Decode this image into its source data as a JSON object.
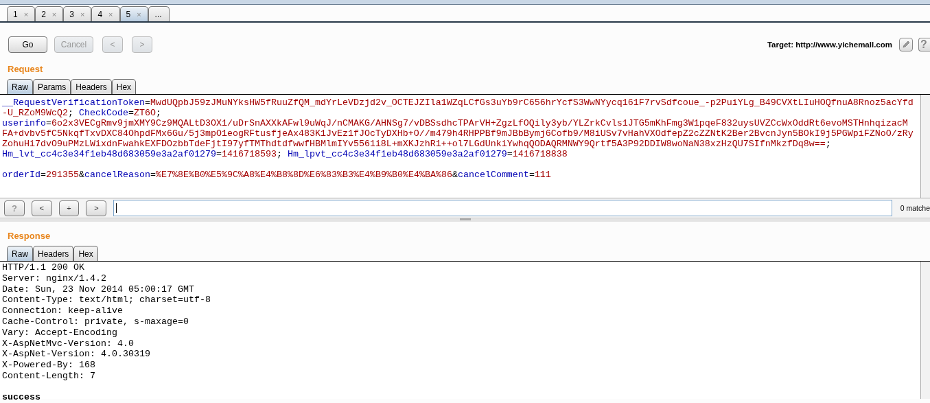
{
  "tabs": [
    {
      "label": "1",
      "close": "×",
      "selected": false
    },
    {
      "label": "2",
      "close": "×",
      "selected": false
    },
    {
      "label": "3",
      "close": "×",
      "selected": false
    },
    {
      "label": "4",
      "close": "×",
      "selected": false
    },
    {
      "label": "5",
      "close": "×",
      "selected": true
    },
    {
      "label": "...",
      "selected": false
    }
  ],
  "toolbar": {
    "buttons": [
      {
        "label": "Go",
        "disabled": false
      },
      {
        "label": "Cancel",
        "disabled": true
      },
      {
        "label": "<",
        "disabled": true
      },
      {
        "label": ">",
        "disabled": true
      }
    ],
    "target": "Target: http://www.yichemall.com",
    "help": "?"
  },
  "request": {
    "title": "Request",
    "tabs": [
      {
        "label": "Raw",
        "selected": true
      },
      {
        "label": "Params",
        "selected": false
      },
      {
        "label": "Headers",
        "selected": false
      },
      {
        "label": "Hex",
        "selected": false
      }
    ],
    "lines": [
      {
        "kind": "params",
        "segments": [
          {
            "kind": "name",
            "text": "__RequestVerificationToken"
          },
          {
            "kind": "punct",
            "text": "="
          },
          {
            "kind": "value",
            "text": "MwdUQpbJ59zJMuNYksHW5fRuuZfQM_mdYrLeVDzjd2v_OCTEJZIla1WZqLCfGs3uYb9rC656hrYcfS3WwNYycq161F7rvSdfcoue_-p2PuiYLg_B49CVXtLIuHOQfnuA8Rnoz5acYfd-U_RZoM9WcQ2"
          },
          {
            "kind": "punct",
            "text": "; "
          },
          {
            "kind": "name",
            "text": "CheckCode"
          },
          {
            "kind": "punct",
            "text": "="
          },
          {
            "kind": "value",
            "text": "ZT6O"
          },
          {
            "kind": "punct",
            "text": ";"
          }
        ]
      },
      {
        "kind": "params",
        "segments": [
          {
            "kind": "name",
            "text": "userinfo"
          },
          {
            "kind": "punct",
            "text": "="
          },
          {
            "kind": "value",
            "text": "6o2x3VECgRmv9jmXMY9Cz9MQALtD3OX1/uDrSnAXXkAFwl9uWqJ/nCMAKG/AHNSg7/vDBSsdhcTPArVH+ZgzLfOQily3yb/YLZrkCvls1JTG5mKhFmg3W1pqeF832uysUVZCcWxOddRt6evoMSTHnhqizacMFA+dvbv5fC5NkqfTxvDXC84OhpdFMx6Gu/5j3mpO1eogRFtusfjeAx483K1JvEz1fJOcTyDXHb+O//m479h4RHPPBf9mJBbBymj6Cofb9/M8iUSv7vHahVXOdfepZ2cZZNtK2Ber2BvcnJyn5BOkI9j5PGWpiFZNoO/zRyZohuHi7dvO9uPMzLWixdnFwahkEXFDOzbbTdeFjtI97yfTMThdtdfwwfHBMlmIYv5561i8L+mXKJzhR1++ol7LGdUnkiYwhqQODAQRMNWY9Qrtf5A3P92DDIW8woNaN38xzHzQU7SIfnMkzfDq8w=="
          },
          {
            "kind": "punct",
            "text": ";"
          }
        ]
      },
      {
        "kind": "params",
        "segments": [
          {
            "kind": "name",
            "text": "Hm_lvt_cc4c3e34f1eb48d683059e3a2af01279"
          },
          {
            "kind": "punct",
            "text": "="
          },
          {
            "kind": "value",
            "text": "1416718593"
          },
          {
            "kind": "punct",
            "text": "; "
          },
          {
            "kind": "name",
            "text": "Hm_lpvt_cc4c3e34f1eb48d683059e3a2af01279"
          },
          {
            "kind": "punct",
            "text": "="
          },
          {
            "kind": "value",
            "text": "1416718838"
          }
        ]
      },
      {
        "kind": "blank"
      },
      {
        "kind": "params",
        "segments": [
          {
            "kind": "name",
            "text": "orderId"
          },
          {
            "kind": "punct",
            "text": "="
          },
          {
            "kind": "value",
            "text": "291355"
          },
          {
            "kind": "punct",
            "text": "&"
          },
          {
            "kind": "name",
            "text": "cancelReason"
          },
          {
            "kind": "punct",
            "text": "="
          },
          {
            "kind": "value",
            "text": "%E7%8E%B0%E5%9C%A8%E4%B8%8D%E6%83%B3%E4%B9%B0%E4%BA%86"
          },
          {
            "kind": "punct",
            "text": "&"
          },
          {
            "kind": "name",
            "text": "cancelComment"
          },
          {
            "kind": "punct",
            "text": "="
          },
          {
            "kind": "value",
            "text": "111"
          }
        ]
      }
    ]
  },
  "search": {
    "buttons": [
      "?",
      "<",
      "+",
      ">"
    ],
    "matches": "0 matche"
  },
  "response": {
    "title": "Response",
    "tabs": [
      {
        "label": "Raw",
        "selected": true
      },
      {
        "label": "Headers",
        "selected": false
      },
      {
        "label": "Hex",
        "selected": false
      }
    ],
    "lines": [
      {
        "kind": "header",
        "text": "HTTP/1.1 200 OK"
      },
      {
        "kind": "header",
        "text": "Server: nginx/1.4.2"
      },
      {
        "kind": "header",
        "text": "Date: Sun, 23 Nov 2014 05:00:17 GMT"
      },
      {
        "kind": "header",
        "text": "Content-Type: text/html; charset=utf-8"
      },
      {
        "kind": "header",
        "text": "Connection: keep-alive"
      },
      {
        "kind": "header",
        "text": "Cache-Control: private, s-maxage=0"
      },
      {
        "kind": "header",
        "text": "Vary: Accept-Encoding"
      },
      {
        "kind": "header",
        "text": "X-AspNetMvc-Version: 4.0"
      },
      {
        "kind": "header",
        "text": "X-AspNet-Version: 4.0.30319"
      },
      {
        "kind": "header",
        "text": "X-Powered-By: 168"
      },
      {
        "kind": "header",
        "text": "Content-Length: 7"
      },
      {
        "kind": "blank"
      },
      {
        "kind": "body",
        "text": "success"
      }
    ]
  }
}
